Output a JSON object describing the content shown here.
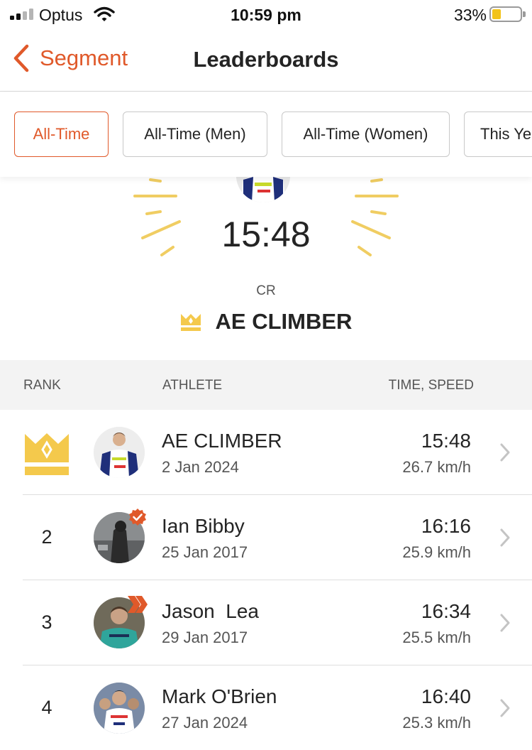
{
  "status_bar": {
    "carrier": "Optus",
    "time": "10:59 pm",
    "battery": "33%"
  },
  "nav": {
    "back_label": "Segment",
    "title": "Leaderboards"
  },
  "filters": [
    {
      "label": "All-Time",
      "active": true
    },
    {
      "label": "All-Time (Men)",
      "active": false
    },
    {
      "label": "All-Time (Women)",
      "active": false
    },
    {
      "label": "This Ye",
      "active": false
    }
  ],
  "hero": {
    "time": "15:48",
    "label": "CR",
    "athlete": "AE CLIMBER"
  },
  "table": {
    "col_rank": "RANK",
    "col_athlete": "ATHLETE",
    "col_time": "TIME, SPEED"
  },
  "entries": [
    {
      "rank": "",
      "crown": true,
      "name": "AE CLIMBER",
      "date": "2 Jan 2024",
      "time": "15:48",
      "speed": "26.7 km/h",
      "badge": ""
    },
    {
      "rank": "2",
      "crown": false,
      "name": "Ian Bibby",
      "date": "25 Jan 2017",
      "time": "16:16",
      "speed": "25.9 km/h",
      "badge": "verified-icon"
    },
    {
      "rank": "3",
      "crown": false,
      "name": "Jason  Lea",
      "date": "29 Jan 2017",
      "time": "16:34",
      "speed": "25.5 km/h",
      "badge": "summit-chevron-icon"
    },
    {
      "rank": "4",
      "crown": false,
      "name": "Mark O'Brien",
      "date": "27 Jan 2024",
      "time": "16:40",
      "speed": "25.3 km/h",
      "badge": ""
    }
  ],
  "colors": {
    "accent": "#e0592a",
    "crown_gold": "#f4c94c",
    "ray_gold": "#f0cd62"
  }
}
